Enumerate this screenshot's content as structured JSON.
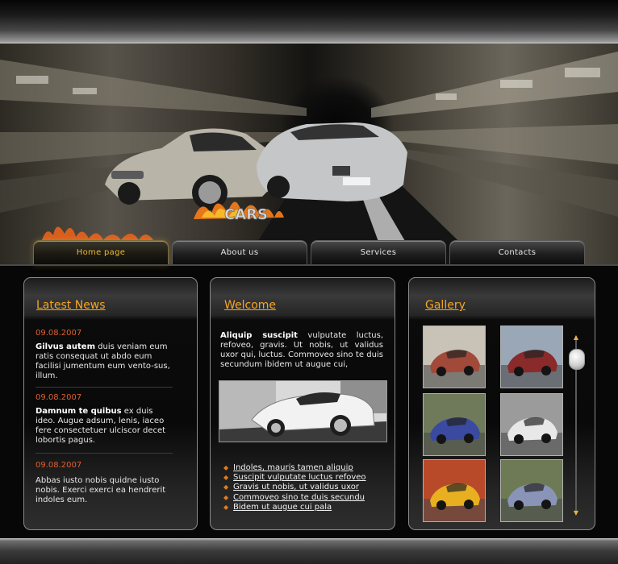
{
  "site": {
    "logo_text": "CARS"
  },
  "nav": {
    "items": [
      {
        "label": "Home page",
        "active": true
      },
      {
        "label": "About us",
        "active": false
      },
      {
        "label": "Services",
        "active": false
      },
      {
        "label": "Contacts",
        "active": false
      }
    ]
  },
  "news": {
    "title": "Latest News",
    "items": [
      {
        "date": "09.08.2007",
        "lead": "Gilvus autem",
        "text": " duis veniam eum ratis consequat ut abdo eum facilisi jumentum eum vento-sus, illum."
      },
      {
        "date": "09.08.2007",
        "lead": "Damnum te quibus",
        "text": " ex duis ideo. Augue adsum, lenis, iaceo fere consectetuer ulciscor decet lobortis pagus."
      },
      {
        "date": "09.08.2007",
        "lead": "",
        "text": "Abbas iusto nobis quidne iusto nobis. Exerci exerci ea hendrerit indoles eum."
      }
    ]
  },
  "welcome": {
    "title": "Welcome",
    "lead": "Aliquip suscipit",
    "text": " vulputate luctus, refoveo, gravis. Ut nobis, ut validus uxor qui, luctus. Commoveo sino te duis secundum ibidem ut augue cui,",
    "links": [
      "Indoles, mauris tamen aliquip",
      "Suscipit vulputate luctus refoveo",
      "Gravis ut nobis, ut validus uxor",
      "Commoveo sino te duis secundu",
      "Bidem ut augue cui pala"
    ]
  },
  "gallery": {
    "title": "Gallery",
    "thumbs": [
      {
        "name": "red-coupe",
        "color": "#a14a3a",
        "bg": "#c9c2b6"
      },
      {
        "name": "red-sedan",
        "color": "#8a2a2a",
        "bg": "#9aa7b7"
      },
      {
        "name": "blue-roadster",
        "color": "#3a4aa0",
        "bg": "#6f7a5a"
      },
      {
        "name": "white-roadster",
        "color": "#e8e8e8",
        "bg": "#9b9b9b"
      },
      {
        "name": "yellow-supercar",
        "color": "#e8b020",
        "bg": "#b84a2a"
      },
      {
        "name": "silver-roadster",
        "color": "#8a94b8",
        "bg": "#6d7a55"
      }
    ]
  }
}
